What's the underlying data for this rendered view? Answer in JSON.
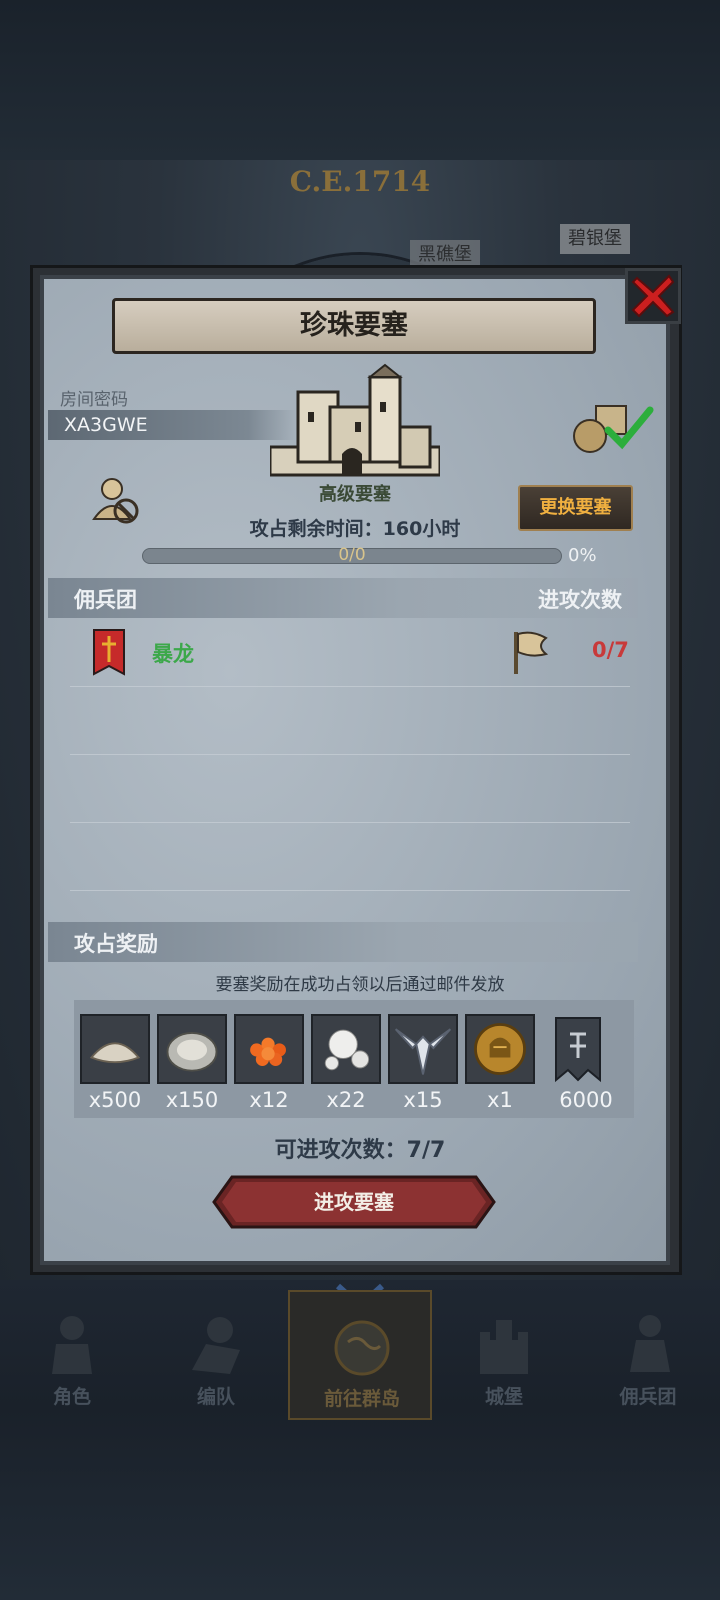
{
  "background": {
    "era": "C.E.1714",
    "tag_left": "黑礁堡",
    "tag_right": "碧银堡"
  },
  "modal": {
    "title": "珍珠要塞",
    "room_label": "房间密码",
    "room_code": "XA3GWE",
    "fort_grade": "高级要塞",
    "change_button": "更换要塞",
    "time_left": "攻占剩余时间：160小时",
    "progress": {
      "text": "0/0",
      "percent_label": "0%",
      "value": 0
    },
    "mercenary_header": "佣兵团",
    "attacks_header": "进攻次数",
    "mercenaries": [
      {
        "name": "暴龙",
        "attacks": "0/7"
      }
    ],
    "reward_header": "攻占奖励",
    "reward_note": "要塞奖励在成功占领以后通过邮件发放",
    "rewards": [
      {
        "icon": "flour-icon",
        "qty": "x500"
      },
      {
        "icon": "oyster-icon",
        "qty": "x150"
      },
      {
        "icon": "roe-icon",
        "qty": "x12"
      },
      {
        "icon": "pearl-icon",
        "qty": "x22"
      },
      {
        "icon": "wing-crest-icon",
        "qty": "x15"
      },
      {
        "icon": "knight-medal-icon",
        "qty": "x1"
      },
      {
        "icon": "guild-banner-icon",
        "qty": "6000"
      }
    ],
    "attacks_available": "可进攻次数：7/7",
    "attack_button": "进攻要塞"
  },
  "nav": [
    {
      "label": "角色",
      "icon": "knight-icon"
    },
    {
      "label": "编队",
      "icon": "squad-icon"
    },
    {
      "label": "前往群岛",
      "icon": "globe-icon",
      "active": true
    },
    {
      "label": "城堡",
      "icon": "castle-icon"
    },
    {
      "label": "佣兵团",
      "icon": "mercenary-icon"
    }
  ],
  "colors": {
    "accent_gold": "#f0b040",
    "merc_green": "#3ca84a",
    "count_red": "#c83a3a",
    "close_red": "#cc1f1f"
  }
}
